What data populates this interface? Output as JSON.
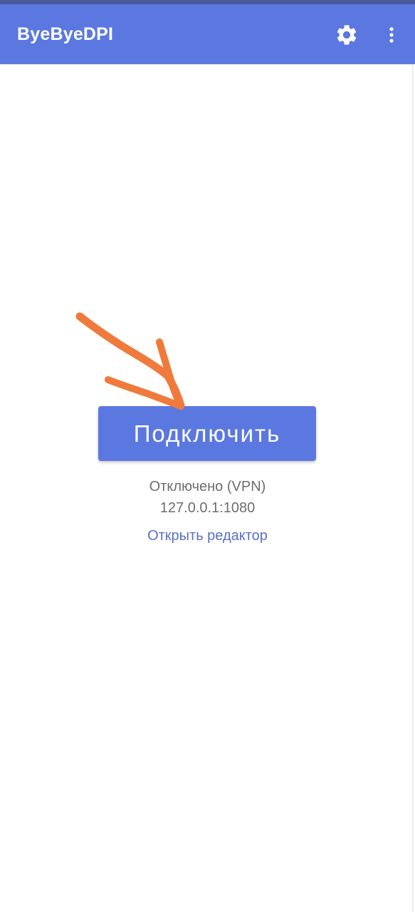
{
  "app_bar": {
    "title": "ByeByeDPI",
    "actions": [
      {
        "icon": "gear-icon",
        "label": ""
      },
      {
        "icon": "more-vert-icon",
        "label": ""
      }
    ],
    "color": "#5b78e0"
  },
  "main": {
    "connect_button_label": "Подключить",
    "status": "Отключено (VPN)",
    "address": "127.0.0.1:1080",
    "editor_link": "Открыть редактор"
  },
  "annotation": {
    "icon": "arrow-annotation",
    "color": "#f07a3c"
  }
}
